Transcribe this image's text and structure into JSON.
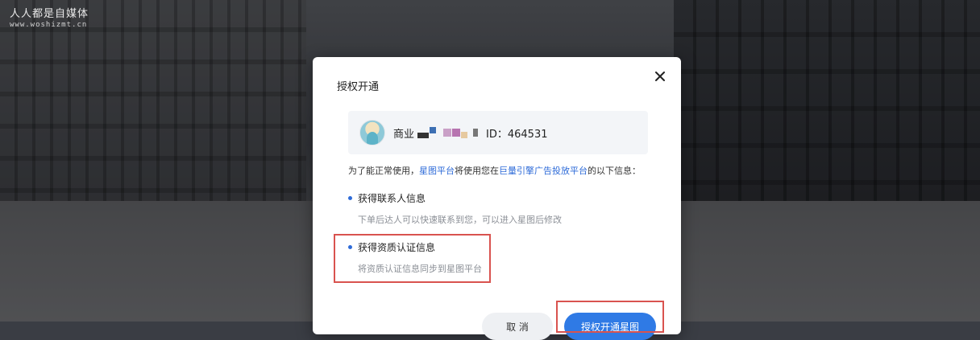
{
  "watermark": {
    "title": "人人都是自媒体",
    "url": "www.woshizmt.cn"
  },
  "modal": {
    "title": "授权开通",
    "account": {
      "name": "商业",
      "id_text": "ID：464531"
    },
    "description": {
      "prefix": "为了能正常使用，",
      "link1": "星图平台",
      "middle": "将使用您在",
      "link2": "巨量引擎广告投放平台",
      "suffix": "的以下信息："
    },
    "items": [
      {
        "title": "获得联系人信息",
        "subtitle": "下单后达人可以快速联系到您，可以进入星图后修改"
      },
      {
        "title": "获得资质认证信息",
        "subtitle": "将资质认证信息同步到星图平台"
      }
    ],
    "buttons": {
      "cancel": "取 消",
      "confirm": "授权开通星图"
    }
  },
  "colors": {
    "accent": "#2e6bd8",
    "highlight": "#d9534f",
    "primary_button": "#2f7ae5"
  },
  "icons": {
    "close": "close-icon",
    "avatar": "avatar"
  }
}
